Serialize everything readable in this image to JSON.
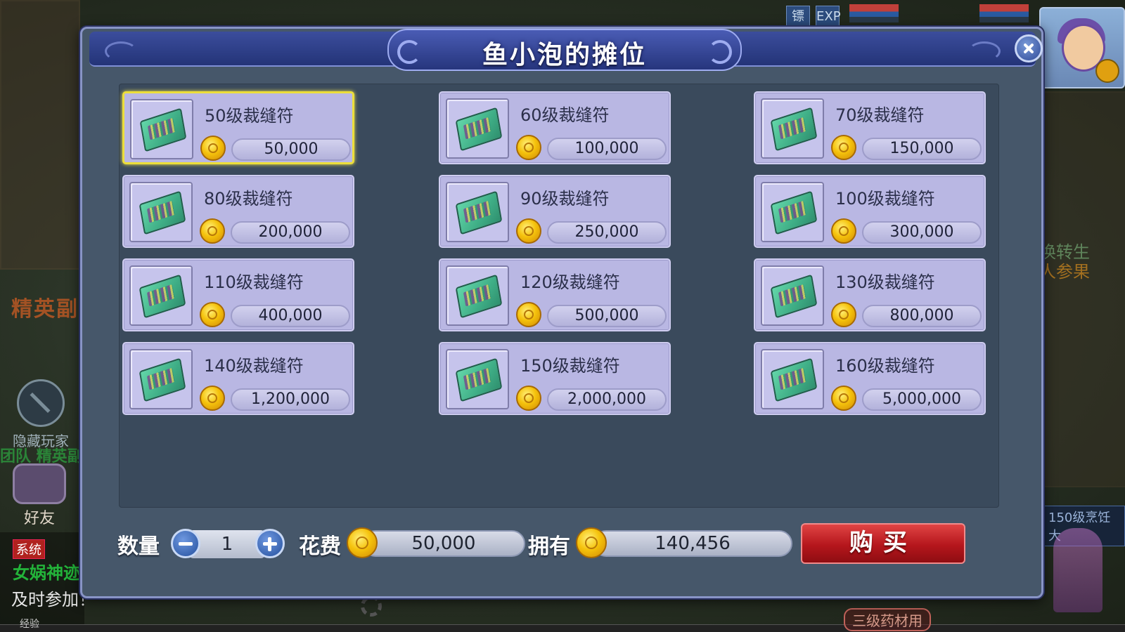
{
  "background": {
    "left_banner": "精英副",
    "hide_players": "隐藏玩家",
    "team_label": "团队 精英副",
    "friends": "好友",
    "chat_system": "系统",
    "chat_event": "女娲神迹",
    "chat_tip": "及时参加！",
    "exp_label": "经验",
    "right_quest_1": "换转生",
    "right_quest_2": "人参果",
    "right_badge": "150级烹饪大",
    "bottom_tag": "三级药材用",
    "top_icons": [
      "镖",
      "EXP"
    ]
  },
  "dialog": {
    "title": "鱼小泡的摊位",
    "close_icon": "close-icon",
    "items": [
      {
        "name": "50级裁缝符",
        "price": "50,000",
        "selected": true
      },
      {
        "name": "60级裁缝符",
        "price": "100,000"
      },
      {
        "name": "70级裁缝符",
        "price": "150,000"
      },
      {
        "name": "80级裁缝符",
        "price": "200,000"
      },
      {
        "name": "90级裁缝符",
        "price": "250,000"
      },
      {
        "name": "100级裁缝符",
        "price": "300,000"
      },
      {
        "name": "110级裁缝符",
        "price": "400,000"
      },
      {
        "name": "120级裁缝符",
        "price": "500,000"
      },
      {
        "name": "130级裁缝符",
        "price": "800,000"
      },
      {
        "name": "140级裁缝符",
        "price": "1,200,000"
      },
      {
        "name": "150级裁缝符",
        "price": "2,000,000"
      },
      {
        "name": "160级裁缝符",
        "price": "5,000,000"
      }
    ],
    "bottom": {
      "quantity_label": "数量",
      "quantity_value": "1",
      "cost_label": "花费",
      "cost_value": "50,000",
      "own_label": "拥有",
      "own_value": "140,456",
      "buy_label": "购买"
    }
  }
}
